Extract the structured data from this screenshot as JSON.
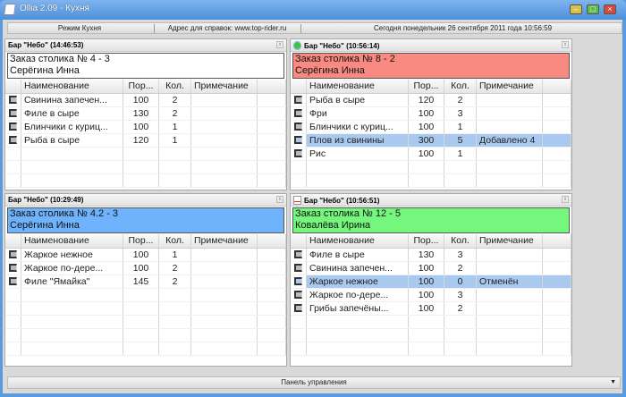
{
  "window": {
    "title": "Ollia 2.09  -  Кухня",
    "buttons": [
      "minimize",
      "maximize",
      "close"
    ]
  },
  "status": {
    "mode": "Режим Кухня",
    "address": "Адрес для справок: www.top-rider.ru",
    "date": "Сегодня  понедельник  26 сентября 2011 года  10:56:59"
  },
  "columns": [
    "Наименование",
    "Пор...",
    "Кол.",
    "Примечание"
  ],
  "panels": [
    {
      "header": "Бар \"Небо\"  (14:46:53)",
      "icon": "",
      "title": "Заказ столика № 4  -  3",
      "waiter": "Серёгина Инна",
      "color": "#ffffff",
      "rows": [
        [
          "Свинина запечен...",
          "100",
          "2",
          ""
        ],
        [
          "Филе в сыре",
          "130",
          "2",
          ""
        ],
        [
          "Блинчики с куриц...",
          "100",
          "1",
          ""
        ],
        [
          "Рыба в сыре",
          "120",
          "1",
          ""
        ]
      ],
      "selected": -1
    },
    {
      "header": "Бар \"Небо\"  (10:56:14)",
      "icon": "download-icon",
      "title": "Заказ столика № 8  -  2",
      "waiter": "Серёгина Инна",
      "color": "#f98a82",
      "rows": [
        [
          "Рыба в сыре",
          "120",
          "2",
          ""
        ],
        [
          "Фри",
          "100",
          "3",
          ""
        ],
        [
          "Блинчики с куриц...",
          "100",
          "1",
          ""
        ],
        [
          "Плов из свинины",
          "300",
          "5",
          "Добавлено 4"
        ],
        [
          "Рис",
          "100",
          "1",
          ""
        ]
      ],
      "selected": 3
    },
    {
      "header": "Бар \"Небо\"  (10:29:49)",
      "icon": "",
      "title": "Заказ столика № 4.2  -  3",
      "waiter": "Серёгина Инна",
      "color": "#6fb3fc",
      "rows": [
        [
          "Жаркое нежное",
          "100",
          "1",
          ""
        ],
        [
          "Жаркое по-дере...",
          "100",
          "2",
          ""
        ],
        [
          "Филе \"Ямайка\"",
          "145",
          "2",
          ""
        ]
      ],
      "selected": -1
    },
    {
      "header": "Бар \"Небо\"  (10:56:51)",
      "icon": "document-icon",
      "title": "Заказ столика № 12  -  5",
      "waiter": "Ковалёва Ирина",
      "color": "#74f77c",
      "rows": [
        [
          "Филе в сыре",
          "130",
          "3",
          ""
        ],
        [
          "Свинина запечен...",
          "100",
          "2",
          ""
        ],
        [
          "Жаркое нежное",
          "100",
          "0",
          "Отменён"
        ],
        [
          "Жаркое по-дере...",
          "100",
          "3",
          ""
        ],
        [
          "Грибы запечёны...",
          "100",
          "2",
          ""
        ]
      ],
      "selected": 2
    }
  ],
  "bottom": {
    "label": "Панель управления"
  }
}
